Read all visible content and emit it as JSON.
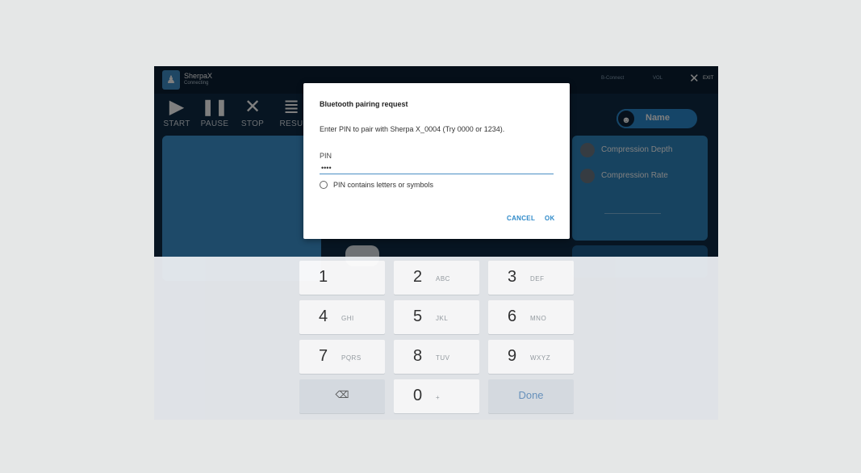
{
  "app": {
    "name": "SherpaX",
    "status": "Connecting"
  },
  "topbar": {
    "bluetooth": "B-Connect",
    "volume": "VOL",
    "exit_label": "EXIT"
  },
  "controls": [
    {
      "label": "START",
      "icon": "play-icon",
      "glyph": "▶"
    },
    {
      "label": "PAUSE",
      "icon": "pause-icon",
      "glyph": "❚❚"
    },
    {
      "label": "STOP",
      "icon": "stop-x-icon",
      "glyph": "✕"
    },
    {
      "label": "RESU",
      "icon": "results-icon",
      "glyph": "≣"
    }
  ],
  "user": {
    "name": "Name",
    "icon": "user-icon",
    "glyph": "☻"
  },
  "metrics": [
    {
      "label": "Compression Depth"
    },
    {
      "label": "Compression Rate"
    }
  ],
  "dialog": {
    "title": "Bluetooth pairing request",
    "message": "Enter PIN to pair with Sherpa X_0004 (Try 0000 or 1234).",
    "pin_label": "PIN",
    "pin_value": "••••",
    "checkbox_label": "PIN contains letters or symbols",
    "cancel_label": "CANCEL",
    "ok_label": "OK"
  },
  "keypad": {
    "keys": [
      {
        "digit": "1",
        "sub": ""
      },
      {
        "digit": "2",
        "sub": "ABC"
      },
      {
        "digit": "3",
        "sub": "DEF"
      },
      {
        "digit": "4",
        "sub": "GHI"
      },
      {
        "digit": "5",
        "sub": "JKL"
      },
      {
        "digit": "6",
        "sub": "MNO"
      },
      {
        "digit": "7",
        "sub": "PQRS"
      },
      {
        "digit": "8",
        "sub": "TUV"
      },
      {
        "digit": "9",
        "sub": "WXYZ"
      },
      {
        "digit": "0",
        "sub": "+"
      }
    ],
    "backspace_glyph": "⌫",
    "done_label": "Done"
  }
}
